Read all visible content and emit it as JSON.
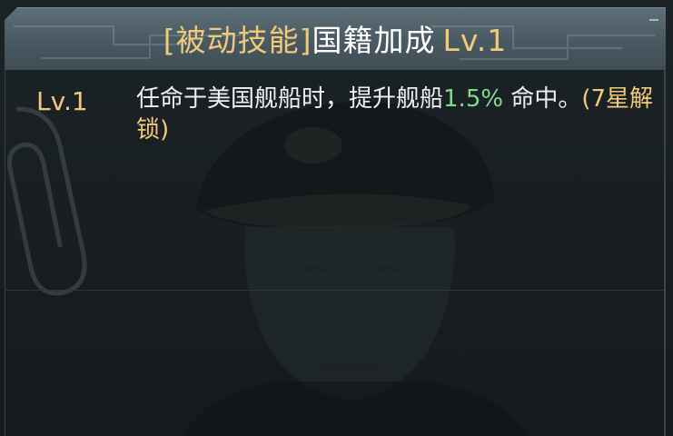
{
  "header": {
    "bracket_label": "[被动技能]",
    "skill_name": "国籍加成",
    "level": "Lv.1"
  },
  "skill": {
    "level_label": "Lv.1",
    "desc_part1": "任命于美国舰船时，提升舰船",
    "bonus_value": "1.5%",
    "desc_part2": "命中。",
    "unlock_note": "(7星解锁)"
  },
  "colors": {
    "gold": "#f1c97a",
    "green": "#82d98a",
    "text": "#eef1f2"
  }
}
